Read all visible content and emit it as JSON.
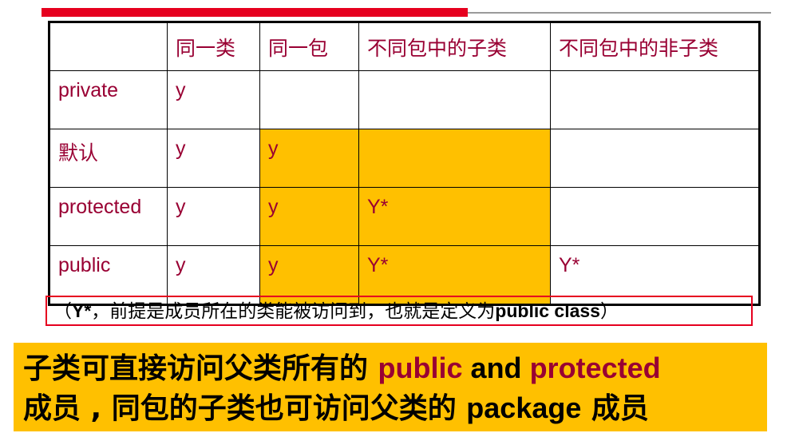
{
  "table": {
    "header": [
      "",
      "同一类",
      "同一包",
      "不同包中的子类",
      "不同包中的非子类"
    ],
    "rows": [
      {
        "label": "private",
        "cells": [
          "y",
          "",
          "",
          ""
        ]
      },
      {
        "label": "默认",
        "cells": [
          "y",
          "y",
          "",
          ""
        ]
      },
      {
        "label": "protected",
        "cells": [
          "y",
          "y",
          "Y*",
          ""
        ]
      },
      {
        "label": "public",
        "cells": [
          "y",
          "y",
          "Y*",
          "Y*"
        ]
      }
    ]
  },
  "note": {
    "open": "（",
    "marker": "Y*",
    "text": "，前提是成员所在的类能被访问到，也就是定义为",
    "keyword": "public class",
    "close": "）"
  },
  "summary": {
    "line1_text": "子类可直接访问父类所有的 ",
    "line1_kw1": "public",
    "line1_and": " and ",
    "line1_kw2": "protected",
    "line2_text": "成员 , 同包的子类也可访问父类的 ",
    "line2_kw": "package",
    "line2_end": " 成员"
  },
  "colors": {
    "accent_red": "#e6001f",
    "highlight": "#ffc000",
    "table_text": "#990033"
  }
}
